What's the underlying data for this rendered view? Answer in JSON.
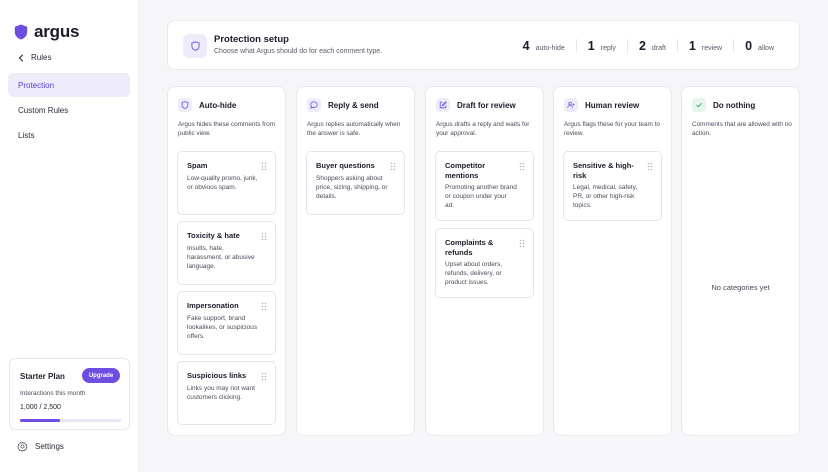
{
  "app": {
    "name": "argus",
    "brand_color": "#6d4ee0"
  },
  "sidebar": {
    "back_label": "Rules",
    "nav": [
      {
        "label": "Protection",
        "active": true
      },
      {
        "label": "Custom Rules",
        "active": false
      },
      {
        "label": "Lists",
        "active": false
      }
    ],
    "plan": {
      "name": "Starter Plan",
      "upgrade_label": "Upgrade",
      "usage_label": "Interactions this month",
      "usage_text": "1,000 / 2,500",
      "usage_fraction": 0.4
    },
    "settings_label": "Settings"
  },
  "header": {
    "title": "Protection setup",
    "subtitle": "Choose what Argus should do for each comment type.",
    "stats": [
      {
        "count": "4",
        "label": "auto-hide"
      },
      {
        "count": "1",
        "label": "reply"
      },
      {
        "count": "2",
        "label": "draft"
      },
      {
        "count": "1",
        "label": "review"
      },
      {
        "count": "0",
        "label": "allow"
      }
    ]
  },
  "columns": [
    {
      "title": "Auto-hide",
      "icon": "shield-icon",
      "description": "Argus hides these comments from public view.",
      "cards": [
        {
          "title": "Spam",
          "description": "Low-quality promo, junk, or obvious spam."
        },
        {
          "title": "Toxicity & hate",
          "description": "Insults, hate, harassment, or abusive language."
        },
        {
          "title": "Impersonation",
          "description": "Fake support, brand lookalikes, or suspicious offers."
        },
        {
          "title": "Suspicious links",
          "description": "Links you may not want customers clicking."
        }
      ]
    },
    {
      "title": "Reply & send",
      "icon": "chat-bubble-icon",
      "description": "Argus replies automatically when the answer is safe.",
      "cards": [
        {
          "title": "Buyer questions",
          "description": "Shoppers asking about price, sizing, shipping, or details."
        }
      ]
    },
    {
      "title": "Draft for review",
      "icon": "edit-icon",
      "description": "Argus drafts a reply and waits for your approval.",
      "cards": [
        {
          "title": "Competitor mentions",
          "description": "Promoting another brand or coupon under your ad."
        },
        {
          "title": "Complaints & refunds",
          "description": "Upset about orders, refunds, delivery, or product issues."
        }
      ]
    },
    {
      "title": "Human review",
      "icon": "user-add-icon",
      "description": "Argus flags these for your team to review.",
      "cards": [
        {
          "title": "Sensitive & high-risk",
          "description": "Legal, medical, safety, PR, or other high-risk topics."
        }
      ]
    },
    {
      "title": "Do nothing",
      "icon": "check-icon",
      "description": "Comments that are allowed with no action.",
      "empty_text": "No categories yet",
      "cards": []
    }
  ]
}
